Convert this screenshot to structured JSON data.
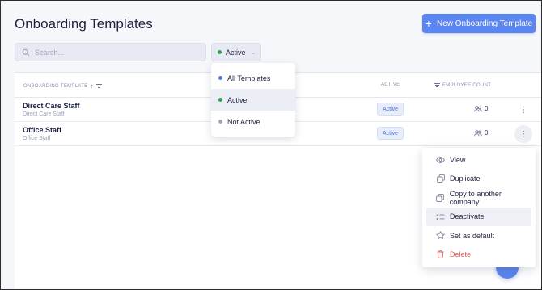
{
  "header": {
    "title": "Onboarding Templates",
    "new_button_label": "New Onboarding Template"
  },
  "filters": {
    "search_placeholder": "Search...",
    "status_selected": "Active",
    "status_options": [
      {
        "label": "All Templates",
        "color": "#4f79e6"
      },
      {
        "label": "Active",
        "color": "#2fa24f"
      },
      {
        "label": "Not Active",
        "color": "#a3a8b8"
      }
    ]
  },
  "table": {
    "columns": {
      "name": "Onboarding Template",
      "active": "Active",
      "employee_count": "Employee Count"
    },
    "rows": [
      {
        "name": "Direct Care Staff",
        "subtitle": "Direct Care Staff",
        "status": "Active",
        "employee_count": "0"
      },
      {
        "name": "Office Staff",
        "subtitle": "Office Staff",
        "status": "Active",
        "employee_count": "0"
      }
    ]
  },
  "row_menu": {
    "items": [
      {
        "label": "View",
        "icon": "eye-icon"
      },
      {
        "label": "Duplicate",
        "icon": "duplicate-icon"
      },
      {
        "label": "Copy to another company",
        "icon": "copy-icon"
      },
      {
        "label": "Deactivate",
        "icon": "deactivate-icon"
      },
      {
        "label": "Set as default",
        "icon": "star-icon"
      },
      {
        "label": "Delete",
        "icon": "trash-icon"
      }
    ]
  },
  "colors": {
    "accent": "#5b86ef",
    "active_dot": "#2fa24f",
    "danger": "#e05a5a"
  }
}
